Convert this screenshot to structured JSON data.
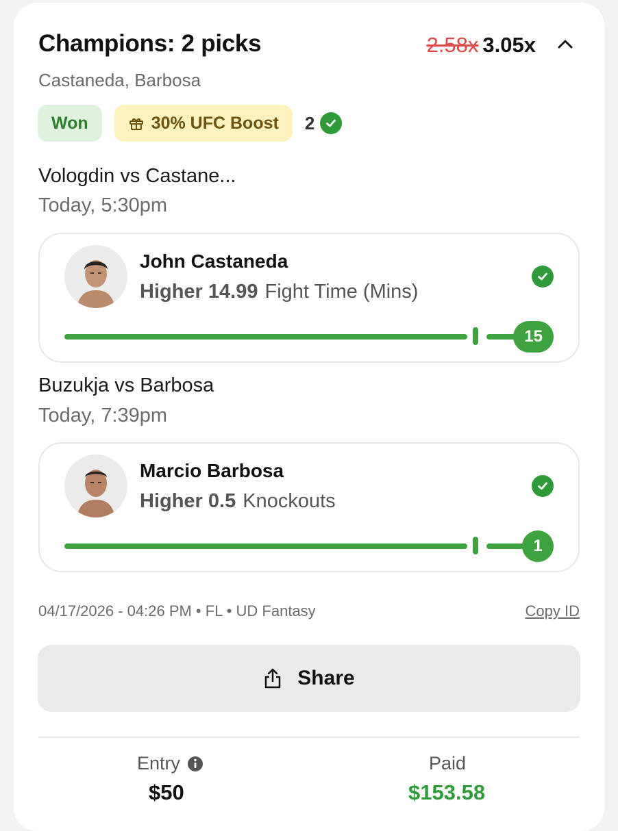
{
  "header": {
    "title": "Champions: 2 picks",
    "old_multiplier": "2.58x",
    "new_multiplier": "3.05x",
    "players_summary": "Castaneda, Barbosa"
  },
  "badges": {
    "status": "Won",
    "boost": "30% UFC Boost",
    "correct_count": "2"
  },
  "picks": [
    {
      "matchup": "Vologdin vs Castane...",
      "time": "Today, 5:30pm",
      "player": "John Castaneda",
      "direction": "Higher 14.99",
      "stat": "Fight Time (Mins)",
      "result": "15"
    },
    {
      "matchup": "Buzukja vs Barbosa",
      "time": "Today, 7:39pm",
      "player": "Marcio Barbosa",
      "direction": "Higher 0.5",
      "stat": "Knockouts",
      "result": "1"
    }
  ],
  "footer": {
    "meta": "04/17/2026 - 04:26 PM • FL • UD Fantasy",
    "copy_id": "Copy ID",
    "share": "Share",
    "entry_label": "Entry",
    "entry_value": "$50",
    "paid_label": "Paid",
    "paid_value": "$153.58"
  },
  "colors": {
    "green": "#2e9a38",
    "strike_red": "#e04848",
    "won_bg": "#def2de",
    "boost_bg": "#fcf2bd"
  },
  "icons": [
    "chevron-up-icon",
    "gift-icon",
    "check-circle-icon",
    "share-icon",
    "info-icon"
  ]
}
